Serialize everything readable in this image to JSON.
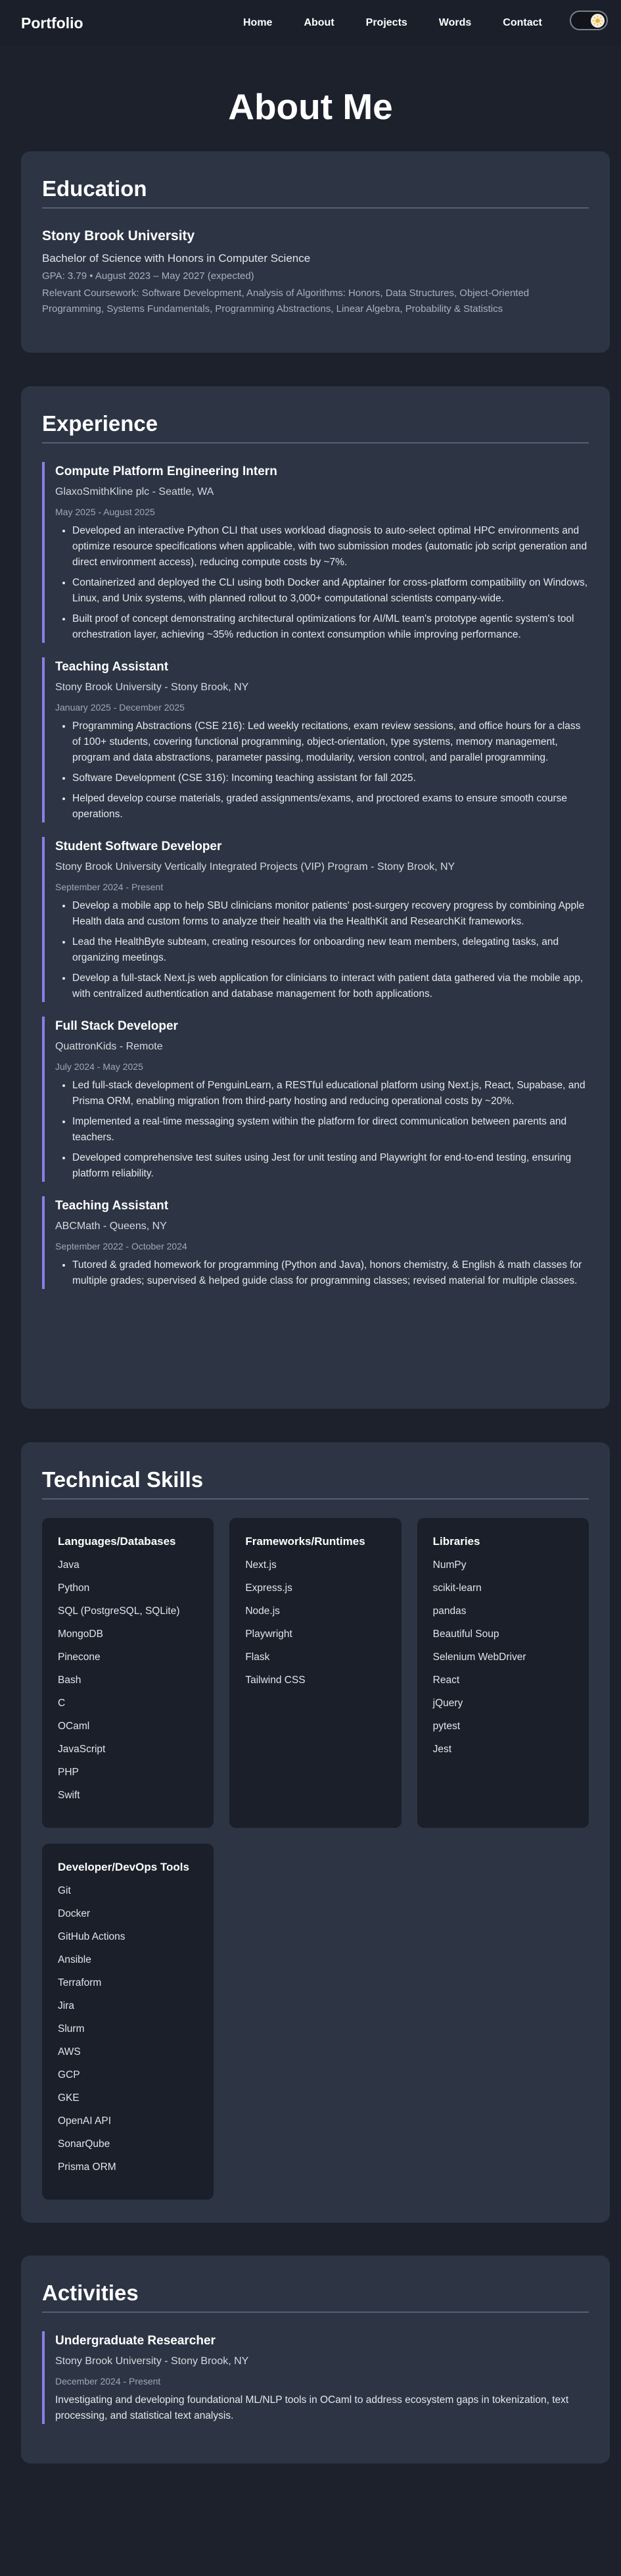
{
  "nav": {
    "brand": "Portfolio",
    "links": [
      "Home",
      "About",
      "Projects",
      "Words",
      "Contact"
    ]
  },
  "page_title": "About Me",
  "education": {
    "heading": "Education",
    "school": "Stony Brook University",
    "degree": "Bachelor of Science with Honors in Computer Science",
    "gpa_line": "GPA: 3.79 • August 2023 – May 2027 (expected)",
    "coursework": "Relevant Coursework: Software Development, Analysis of Algorithms: Honors, Data Structures, Object-Oriented Programming, Systems Fundamentals, Programming Abstractions, Linear Algebra, Probability & Statistics"
  },
  "experience": {
    "heading": "Experience",
    "entries": [
      {
        "title": "Compute Platform Engineering Intern",
        "org": "GlaxoSmithKline plc - Seattle, WA",
        "dates": "May 2025 - August 2025",
        "bullets": [
          "Developed an interactive Python CLI that uses workload diagnosis to auto-select optimal HPC environments and optimize resource specifications when applicable, with two submission modes (automatic job script generation and direct environment access), reducing compute costs by ~7%.",
          "Containerized and deployed the CLI using both Docker and Apptainer for cross-platform compatibility on Windows, Linux, and Unix systems, with planned rollout to 3,000+ computational scientists company-wide.",
          "Built proof of concept demonstrating architectural optimizations for AI/ML team's prototype agentic system's tool orchestration layer, achieving ~35% reduction in context consumption while improving performance."
        ]
      },
      {
        "title": "Teaching Assistant",
        "org": "Stony Brook University - Stony Brook, NY",
        "dates": "January 2025 - December 2025",
        "bullets": [
          "Programming Abstractions (CSE 216): Led weekly recitations, exam review sessions, and office hours for a class of 100+ students, covering functional programming, object-orientation, type systems, memory management, program and data abstractions, parameter passing, modularity, version control, and parallel programming.",
          "Software Development (CSE 316): Incoming teaching assistant for fall 2025.",
          "Helped develop course materials, graded assignments/exams, and proctored exams to ensure smooth course operations."
        ]
      },
      {
        "title": "Student Software Developer",
        "org": "Stony Brook University Vertically Integrated Projects (VIP) Program - Stony Brook, NY",
        "dates": "September 2024 - Present",
        "bullets": [
          "Develop a mobile app to help SBU clinicians monitor patients' post-surgery recovery progress by combining Apple Health data and custom forms to analyze their health via the HealthKit and ResearchKit frameworks.",
          "Lead the HealthByte subteam, creating resources for onboarding new team members, delegating tasks, and organizing meetings.",
          "Develop a full-stack Next.js web application for clinicians to interact with patient data gathered via the mobile app, with centralized authentication and database management for both applications."
        ]
      },
      {
        "title": "Full Stack Developer",
        "org": "QuattronKids - Remote",
        "dates": "July 2024 - May 2025",
        "bullets": [
          "Led full-stack development of PenguinLearn, a RESTful educational platform using Next.js, React, Supabase, and Prisma ORM, enabling migration from third-party hosting and reducing operational costs by ~20%.",
          "Implemented a real-time messaging system within the platform for direct communication between parents and teachers.",
          "Developed comprehensive test suites using Jest for unit testing and Playwright for end-to-end testing, ensuring platform reliability."
        ]
      },
      {
        "title": "Teaching Assistant",
        "org": "ABCMath - Queens, NY",
        "dates": "September 2022 - October 2024",
        "bullets": [
          "Tutored & graded homework for programming (Python and Java), honors chemistry, & English & math classes for multiple grades; supervised & helped guide class for programming classes; revised material for multiple classes."
        ]
      }
    ]
  },
  "skills": {
    "heading": "Technical Skills",
    "groups": [
      {
        "title": "Languages/Databases",
        "items": [
          "Java",
          "Python",
          "SQL (PostgreSQL, SQLite)",
          "MongoDB",
          "Pinecone",
          "Bash",
          "C",
          "OCaml",
          "JavaScript",
          "PHP",
          "Swift"
        ]
      },
      {
        "title": "Frameworks/Runtimes",
        "items": [
          "Next.js",
          "Express.js",
          "Node.js",
          "Playwright",
          "Flask",
          "Tailwind CSS"
        ]
      },
      {
        "title": "Libraries",
        "items": [
          "NumPy",
          "scikit-learn",
          "pandas",
          "Beautiful Soup",
          "Selenium WebDriver",
          "React",
          "jQuery",
          "pytest",
          "Jest"
        ]
      },
      {
        "title": "Developer/DevOps Tools",
        "items": [
          "Git",
          "Docker",
          "GitHub Actions",
          "Ansible",
          "Terraform",
          "Jira",
          "Slurm",
          "AWS",
          "GCP",
          "GKE",
          "OpenAI API",
          "SonarQube",
          "Prisma ORM"
        ]
      }
    ]
  },
  "activities": {
    "heading": "Activities",
    "entries": [
      {
        "title": "Undergraduate Researcher",
        "org": "Stony Brook University - Stony Brook, NY",
        "dates": "December 2024 - Present",
        "text": "Investigating and developing foundational ML/NLP tools in OCaml to address ecosystem gaps in tokenization, text processing, and statistical text analysis."
      }
    ]
  },
  "colors": {
    "background": "#1c212c",
    "card": "#2d3544",
    "accent_border": "#8b7fe8",
    "skill_box": "#1b1f29"
  },
  "icons": {
    "theme_toggle": "sun-moon-icon"
  }
}
